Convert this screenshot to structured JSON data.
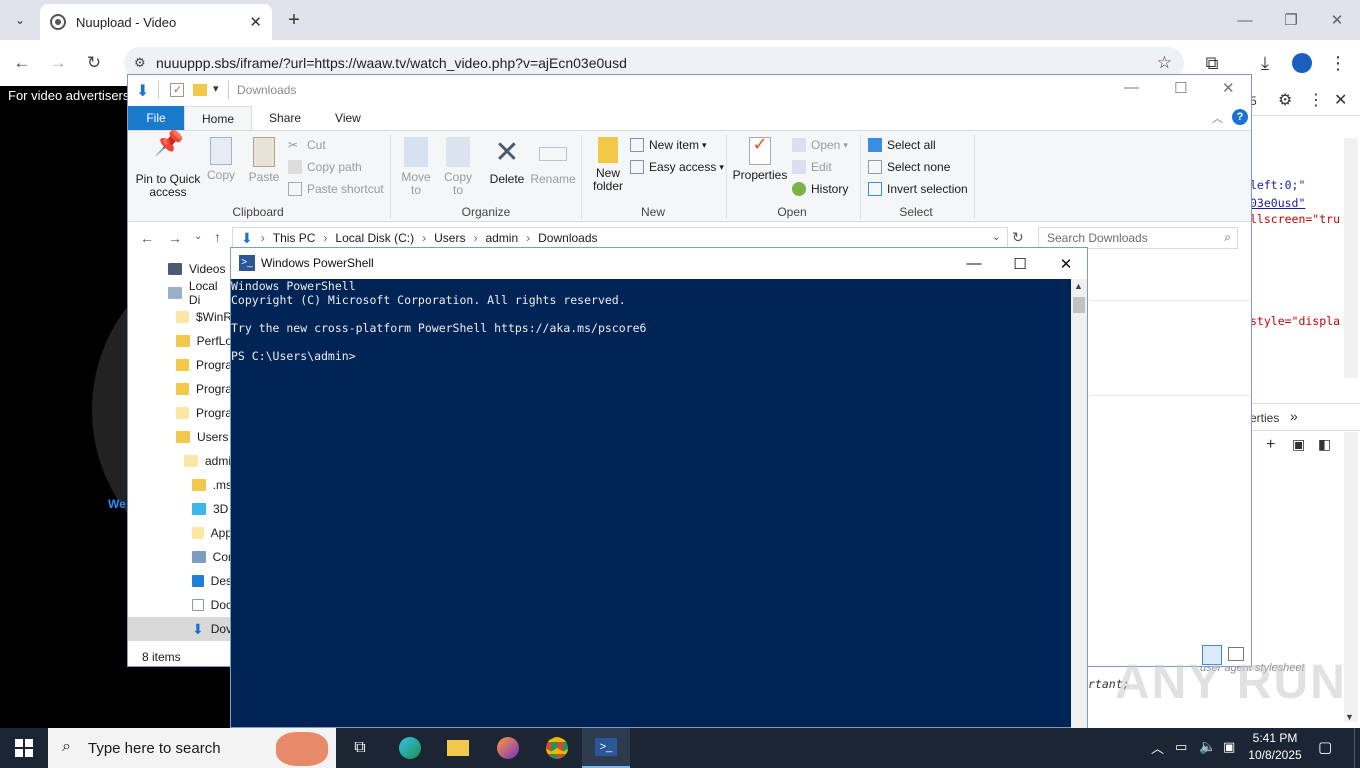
{
  "browser": {
    "tab_title": "Nuupload - Video",
    "url": "nuuuppp.sbs/iframe/?url=https://waaw.tv/watch_video.php?v=ajEcn03e0usd"
  },
  "page": {
    "ad_text": "For video advertisers",
    "partial_text": "We"
  },
  "devtools": {
    "tab_fragment": "5",
    "code_lines": [
      "left:0;\"",
      "03e0usd\"",
      "llscreen=\"tru",
      "style=\"displa"
    ],
    "panel_label": "erties",
    "style_fragment": "rtant;",
    "ua_label": "user agent stylesheet"
  },
  "explorer": {
    "title": "Downloads",
    "ribbon_tabs": [
      "File",
      "Home",
      "Share",
      "View"
    ],
    "clipboard": {
      "pin": "Pin to Quick access",
      "copy": "Copy",
      "paste": "Paste",
      "cut": "Cut",
      "copy_path": "Copy path",
      "paste_shortcut": "Paste shortcut",
      "label": "Clipboard"
    },
    "organize": {
      "move_to": "Move to",
      "copy_to": "Copy to",
      "delete": "Delete",
      "rename": "Rename",
      "label": "Organize"
    },
    "new": {
      "new_folder": "New folder",
      "new_item": "New item",
      "easy_access": "Easy access",
      "label": "New"
    },
    "open": {
      "properties": "Properties",
      "open": "Open",
      "edit": "Edit",
      "history": "History",
      "label": "Open"
    },
    "select": {
      "select_all": "Select all",
      "select_none": "Select none",
      "invert": "Invert selection",
      "label": "Select"
    },
    "breadcrumb": [
      "This PC",
      "Local Disk (C:)",
      "Users",
      "admin",
      "Downloads"
    ],
    "search_placeholder": "Search Downloads",
    "tree": [
      {
        "label": "Videos",
        "icon": "videos-icon"
      },
      {
        "label": "Local Di",
        "icon": "drive-icon"
      },
      {
        "label": "$WinR",
        "icon": "folder-icon"
      },
      {
        "label": "PerfLo",
        "icon": "folder-icon"
      },
      {
        "label": "Progra",
        "icon": "folder-icon"
      },
      {
        "label": "Progra",
        "icon": "folder-icon"
      },
      {
        "label": "Progra",
        "icon": "folder-icon"
      },
      {
        "label": "Users",
        "icon": "folder-icon"
      },
      {
        "label": "admi",
        "icon": "folder-icon"
      },
      {
        "label": ".ms",
        "icon": "folder-icon"
      },
      {
        "label": "3D",
        "icon": "3d-objects-icon"
      },
      {
        "label": "App",
        "icon": "folder-icon"
      },
      {
        "label": "Cor",
        "icon": "contacts-icon"
      },
      {
        "label": "Des",
        "icon": "desktop-icon"
      },
      {
        "label": "Doc",
        "icon": "documents-icon"
      },
      {
        "label": "Dov",
        "icon": "downloads-icon"
      }
    ],
    "status": "8 items"
  },
  "powershell": {
    "title": "Windows PowerShell",
    "lines": [
      "Windows PowerShell",
      "Copyright (C) Microsoft Corporation. All rights reserved.",
      "",
      "Try the new cross-platform PowerShell https://aka.ms/pscore6",
      "",
      "PS C:\\Users\\admin>"
    ]
  },
  "taskbar": {
    "search_placeholder": "Type here to search",
    "time": "5:41 PM",
    "date": "10/8/2025"
  },
  "watermark": "ANY RUN",
  "colors": {
    "ps_background": "#012456",
    "taskbar": "#1c2533",
    "accent": "#0063b1"
  }
}
